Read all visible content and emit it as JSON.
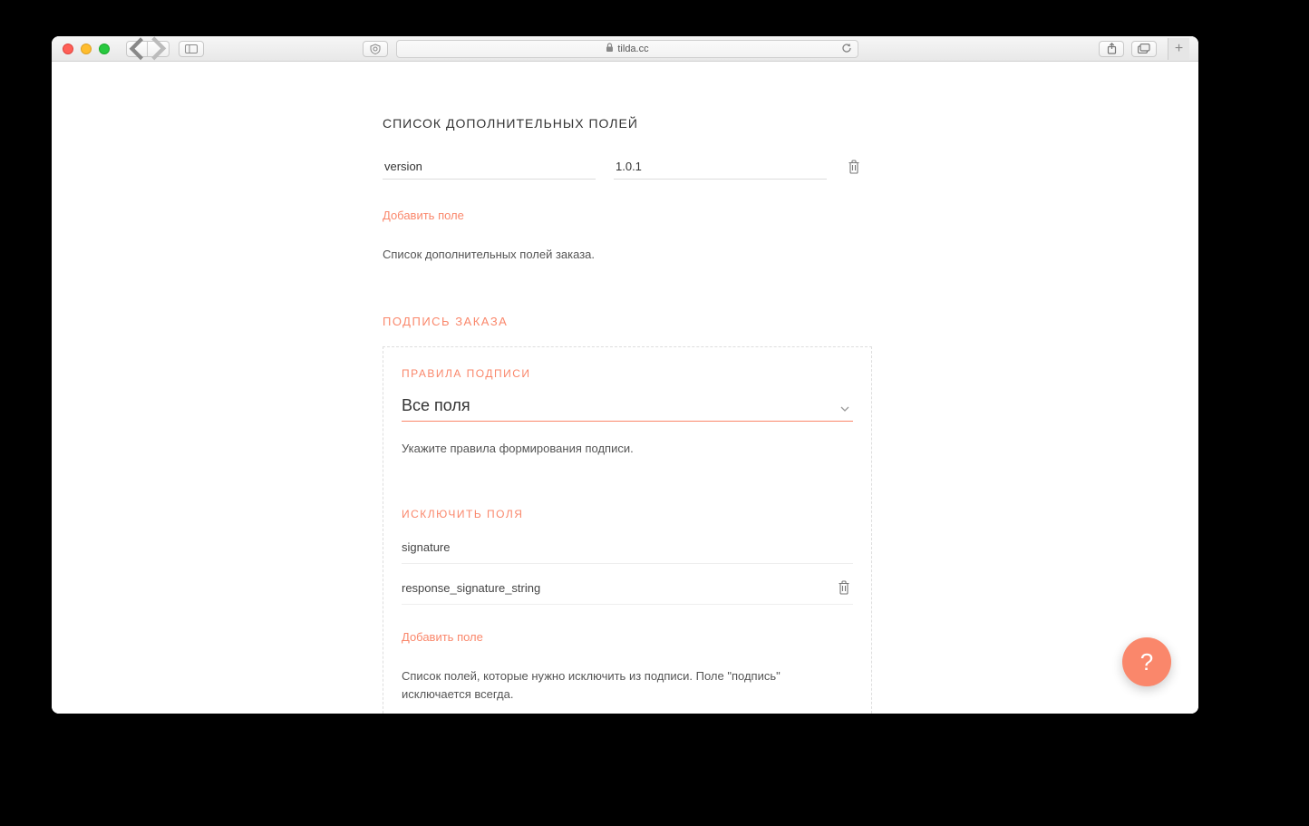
{
  "browser": {
    "url": "tilda.cc"
  },
  "section_extra_fields": {
    "title": "СПИСОК ДОПОЛНИТЕЛЬНЫХ ПОЛЕЙ",
    "rows": [
      {
        "key": "version",
        "value": "1.0.1"
      }
    ],
    "add_label": "Добавить поле",
    "help": "Список дополнительных полей заказа."
  },
  "section_signature": {
    "title": "ПОДПИСЬ ЗАКАЗА",
    "rules": {
      "title": "ПРАВИЛА ПОДПИСИ",
      "selected": "Все поля",
      "help": "Укажите правила формирования подписи."
    },
    "exclude": {
      "title": "ИСКЛЮЧИТЬ ПОЛЯ",
      "rows": [
        {
          "value": "signature",
          "deletable": false
        },
        {
          "value": "response_signature_string",
          "deletable": true
        }
      ],
      "add_label": "Добавить поле",
      "help": "Список полей, которые нужно исключить из подписи. Поле \"подпись\" исключается всегда."
    }
  },
  "help_bubble": "?"
}
